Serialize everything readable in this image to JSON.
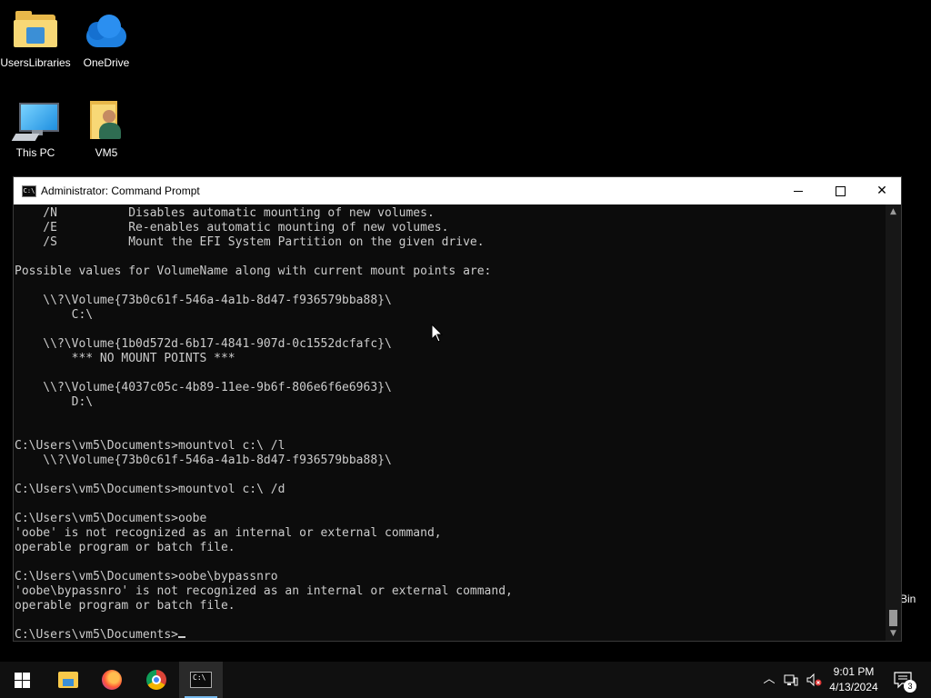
{
  "desktop": {
    "icons": [
      {
        "label": "UsersLibraries",
        "icon": "libraries-folder-icon"
      },
      {
        "label": "OneDrive",
        "icon": "onedrive-cloud-icon"
      },
      {
        "label": "This PC",
        "icon": "this-pc-icon"
      },
      {
        "label": "VM5",
        "icon": "user-folder-icon"
      }
    ],
    "partial_label": "Bin"
  },
  "window": {
    "title": "Administrator: Command Prompt",
    "icon": "cmd-icon",
    "controls": {
      "minimize": "minimize",
      "maximize": "maximize",
      "close": "close"
    },
    "console_lines": [
      "    /N          Disables automatic mounting of new volumes.",
      "    /E          Re-enables automatic mounting of new volumes.",
      "    /S          Mount the EFI System Partition on the given drive.",
      "",
      "Possible values for VolumeName along with current mount points are:",
      "",
      "    \\\\?\\Volume{73b0c61f-546a-4a1b-8d47-f936579bba88}\\",
      "        C:\\",
      "",
      "    \\\\?\\Volume{1b0d572d-6b17-4841-907d-0c1552dcfafc}\\",
      "        *** NO MOUNT POINTS ***",
      "",
      "    \\\\?\\Volume{4037c05c-4b89-11ee-9b6f-806e6f6e6963}\\",
      "        D:\\",
      "",
      "",
      "C:\\Users\\vm5\\Documents>mountvol c:\\ /l",
      "    \\\\?\\Volume{73b0c61f-546a-4a1b-8d47-f936579bba88}\\",
      "",
      "C:\\Users\\vm5\\Documents>mountvol c:\\ /d",
      "",
      "C:\\Users\\vm5\\Documents>oobe",
      "'oobe' is not recognized as an internal or external command,",
      "operable program or batch file.",
      "",
      "C:\\Users\\vm5\\Documents>oobe\\bypassnro",
      "'oobe\\bypassnro' is not recognized as an internal or external command,",
      "operable program or batch file.",
      ""
    ],
    "prompt": "C:\\Users\\vm5\\Documents>"
  },
  "taskbar": {
    "apps": [
      {
        "name": "start",
        "icon": "windows-logo-icon"
      },
      {
        "name": "file-explorer",
        "icon": "file-explorer-icon"
      },
      {
        "name": "firefox",
        "icon": "firefox-icon"
      },
      {
        "name": "chrome",
        "icon": "chrome-icon"
      },
      {
        "name": "command-prompt",
        "icon": "cmd-icon",
        "active": true
      }
    ],
    "tray": {
      "time": "9:01 PM",
      "date": "4/13/2024",
      "notification_count": "3"
    }
  },
  "colors": {
    "console_bg": "#0c0c0c",
    "console_text": "#cccccc",
    "taskbar_bg": "#101010",
    "active_indicator": "#76b9ed"
  }
}
